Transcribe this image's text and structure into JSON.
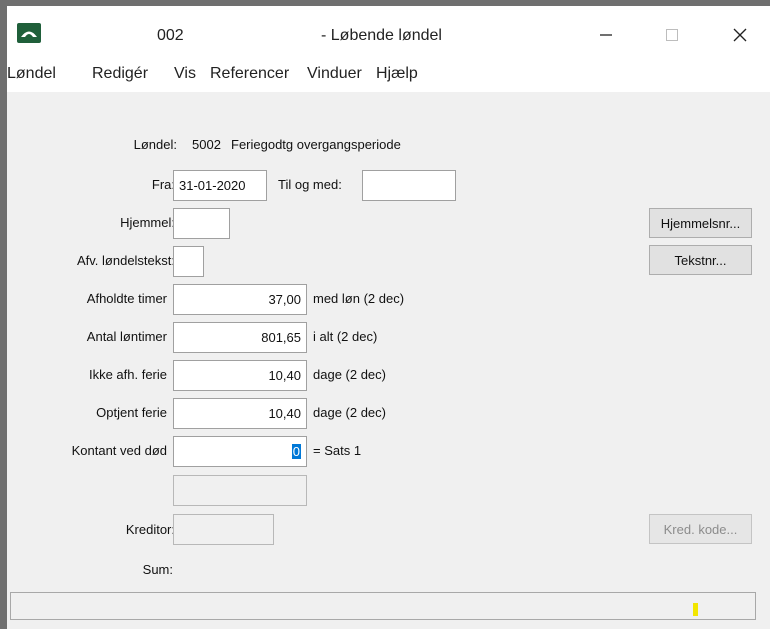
{
  "window": {
    "title_number": "002",
    "title_name": "- Løbende løndel",
    "icon": "app-logo-icon",
    "controls": {
      "minimize": "minimize-icon",
      "maximize": "maximize-icon",
      "close": "close-icon"
    }
  },
  "menu": [
    "Løndel",
    "Redigér",
    "Vis",
    "Referencer",
    "Vinduer",
    "Hjælp"
  ],
  "form": {
    "londel": {
      "label": "Løndel:",
      "code": "5002",
      "description": "Feriegodtg overgangsperiode"
    },
    "fra": {
      "label": "Fra:",
      "value": "31-01-2020"
    },
    "til_og_med": {
      "label": "Til og med:",
      "value": ""
    },
    "hjemmel": {
      "label": "Hjemmel:",
      "value": ""
    },
    "afv_londelstekst": {
      "label": "Afv. løndelstekst:",
      "value": ""
    },
    "afholdte_timer": {
      "label": "Afholdte timer",
      "value": "37,00",
      "suffix": "med løn (2 dec)"
    },
    "antal_lontimer": {
      "label": "Antal løntimer",
      "value": "801,65",
      "suffix": "i alt (2 dec)"
    },
    "ikke_afh_ferie": {
      "label": "Ikke afh. ferie",
      "value": "10,40",
      "suffix": "dage (2 dec)"
    },
    "optjent_ferie": {
      "label": "Optjent ferie",
      "value": "10,40",
      "suffix": "dage (2 dec)"
    },
    "kontant_ved_dod": {
      "label": "Kontant ved død",
      "value": "0",
      "suffix": "= Sats 1"
    },
    "extra_field": {
      "value": ""
    },
    "kreditor": {
      "label": "Kreditor:",
      "value": ""
    },
    "sum": {
      "label": "Sum:",
      "value": ""
    }
  },
  "buttons": {
    "hjemmelsnr": "Hjemmelsnr...",
    "tekstnr": "Tekstnr...",
    "kred_kode": "Kred. kode..."
  },
  "status": {
    "text": ""
  },
  "colors": {
    "selection": "#0078d7",
    "status_marker": "#f2e600",
    "client_bg": "#f0f0f0"
  }
}
